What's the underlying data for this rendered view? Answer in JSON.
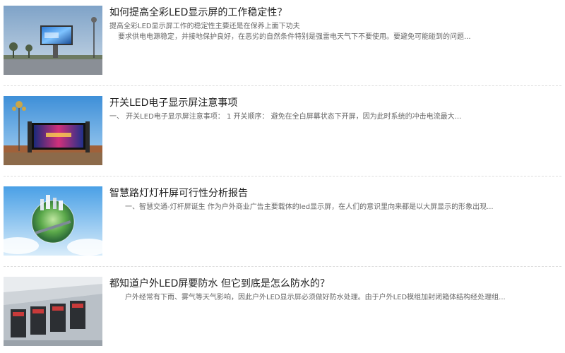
{
  "articles": [
    {
      "image": "outdoor-led-billboard-image",
      "title": "如何提高全彩LED显示屏的工作稳定性？",
      "subtitle": "提高全彩LED显示屏工作的稳定性主要还是在保养上面下功夫",
      "summary": "要求供电电源稳定，并接地保护良好，在恶劣的自然条件特别是强雷电天气下不要使用。要避免可能碰到的问题..."
    },
    {
      "image": "stage-led-screen-image",
      "title": "开关LED电子显示屏注意事项",
      "summary": "一、 开关LED电子显示屏注意事项：       1 开关顺序：  避免在全白屏幕状态下开屏，因为此时系统的冲击电流最大..."
    },
    {
      "image": "smart-city-globe-image",
      "title": "智慧路灯灯杆屏可行性分析报告",
      "summary": "一、智慧交通-灯杆屏诞生        作为户外商业广告主要载体的led显示屏，在人们的意识里向来都是以大屏显示的形象出现..."
    },
    {
      "image": "led-cabinet-modules-image",
      "title": "都知道户外LED屏要防水 但它到底是怎么防水的？",
      "summary": "户外经常有下雨、雾气等天气影响，因此户外LED显示屏必须做好防水处理。由于户外LED模组加封闭箱体结构经处理组..."
    }
  ]
}
